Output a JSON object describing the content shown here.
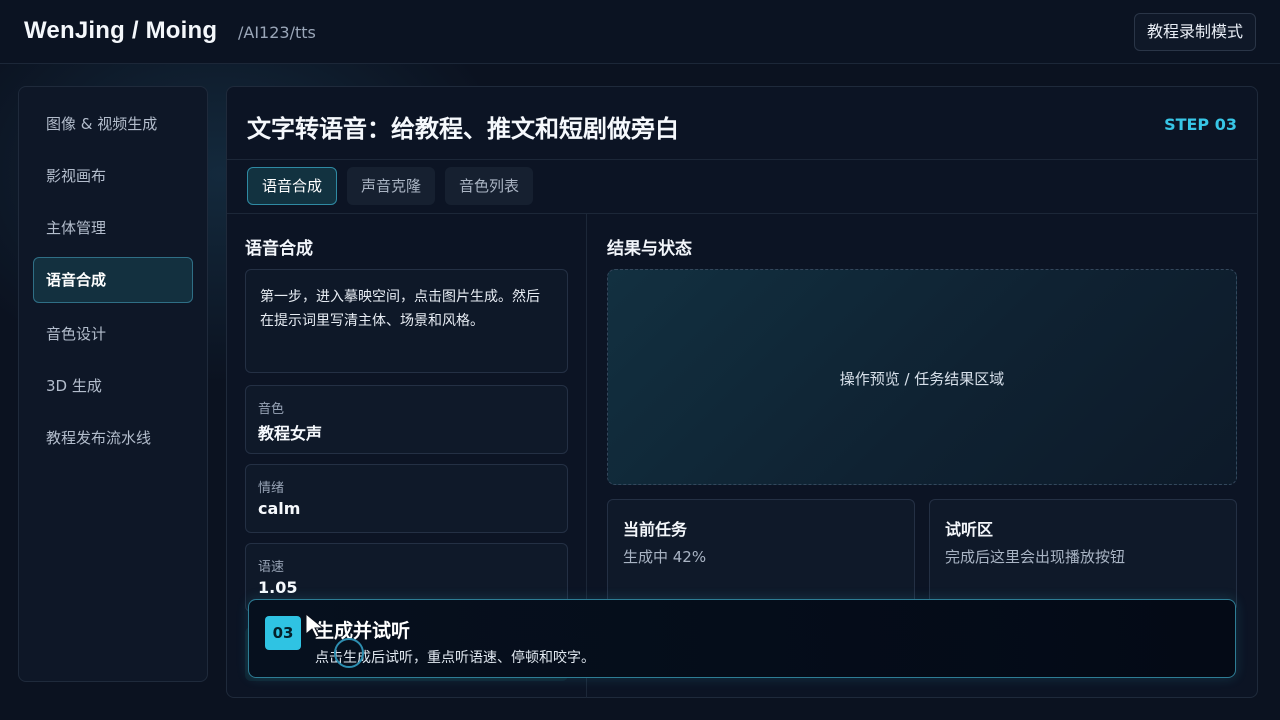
{
  "header": {
    "brand": "WenJing / Moing",
    "path": "/AI123/tts",
    "mode_button": "教程录制模式"
  },
  "sidebar": {
    "items": [
      {
        "label": "图像 & 视频生成",
        "active": false
      },
      {
        "label": "影视画布",
        "active": false
      },
      {
        "label": "主体管理",
        "active": false
      },
      {
        "label": "语音合成",
        "active": true
      },
      {
        "label": "音色设计",
        "active": false
      },
      {
        "label": "3D 生成",
        "active": false
      },
      {
        "label": "教程发布流水线",
        "active": false
      }
    ]
  },
  "main": {
    "title": "文字转语音：给教程、推文和短剧做旁白",
    "step": "STEP 03",
    "tabs": [
      {
        "label": "语音合成",
        "active": true
      },
      {
        "label": "声音克隆",
        "active": false
      },
      {
        "label": "音色列表",
        "active": false
      }
    ],
    "left": {
      "title": "语音合成",
      "text_value": "第一步，进入摹映空间，点击图片生成。然后在提示词里写清主体、场景和风格。",
      "fields": [
        {
          "label": "音色",
          "value": "教程女声"
        },
        {
          "label": "情绪",
          "value": "calm"
        },
        {
          "label": "语速",
          "value": "1.05"
        }
      ]
    },
    "right": {
      "title": "结果与状态",
      "preview_text": "操作预览 / 任务结果区域",
      "current_task": {
        "title": "当前任务",
        "value": "生成中 42%"
      },
      "listen": {
        "title": "试听区",
        "value": "完成后这里会出现播放按钮"
      }
    }
  },
  "tip": {
    "number": "03",
    "title": "生成并试听",
    "description": "点击生成后试听，重点听语速、停顿和咬字。"
  },
  "colors": {
    "accent": "#38c6e6",
    "background": "#0b1220"
  }
}
